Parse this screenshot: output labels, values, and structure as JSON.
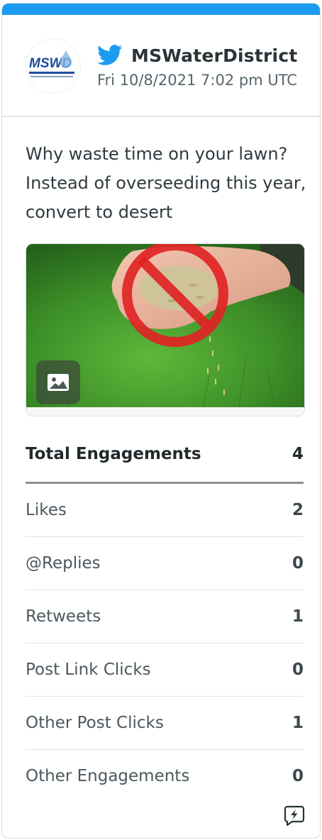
{
  "post": {
    "network_icon": "twitter-bird-icon",
    "handle": "MSWaterDistrict",
    "timestamp": "Fri 10/8/2021 7:02 pm UTC",
    "avatar_logo_text": "MSWD",
    "text": "Why waste time on your lawn? Instead of overseeding this year, convert to desert",
    "media_type_icon": "image-icon"
  },
  "stats": {
    "total": {
      "label": "Total Engagements",
      "value": "4"
    },
    "rows": [
      {
        "label": "Likes",
        "value": "2"
      },
      {
        "label": "@Replies",
        "value": "0"
      },
      {
        "label": "Retweets",
        "value": "1"
      },
      {
        "label": "Post Link Clicks",
        "value": "0"
      },
      {
        "label": "Other Post Clicks",
        "value": "1"
      },
      {
        "label": "Other Engagements",
        "value": "0"
      }
    ]
  },
  "footer_icon": "boost-lightning-icon",
  "colors": {
    "accent": "#1d9bf0",
    "text_dark": "#22292c",
    "text_muted": "#56646b"
  }
}
